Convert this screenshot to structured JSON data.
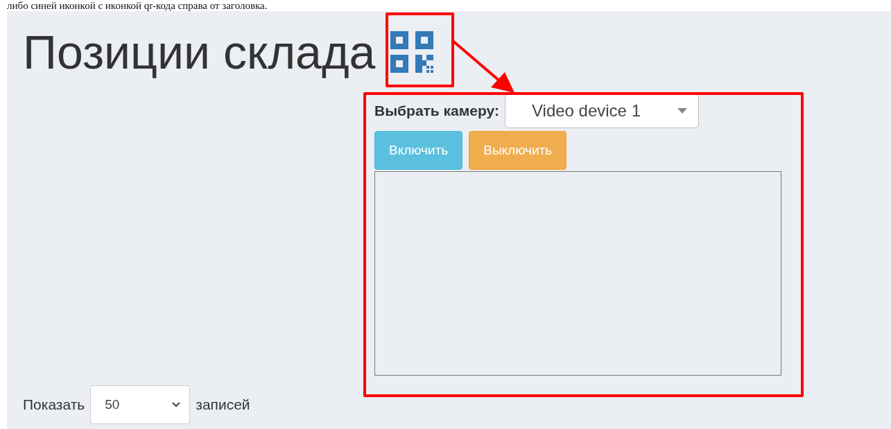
{
  "caption": "либо синей иконкой с иконкой qr-кода справа от заголовка.",
  "title": "Позиции склада",
  "camera": {
    "label": "Выбрать камеру:",
    "device": "Video device 1",
    "buttons": [
      {
        "label": "Включить",
        "kind": "info"
      },
      {
        "label": "Выключить",
        "kind": "warning"
      }
    ]
  },
  "length": {
    "prefix": "Показать",
    "value": "50",
    "suffix": "записей"
  }
}
